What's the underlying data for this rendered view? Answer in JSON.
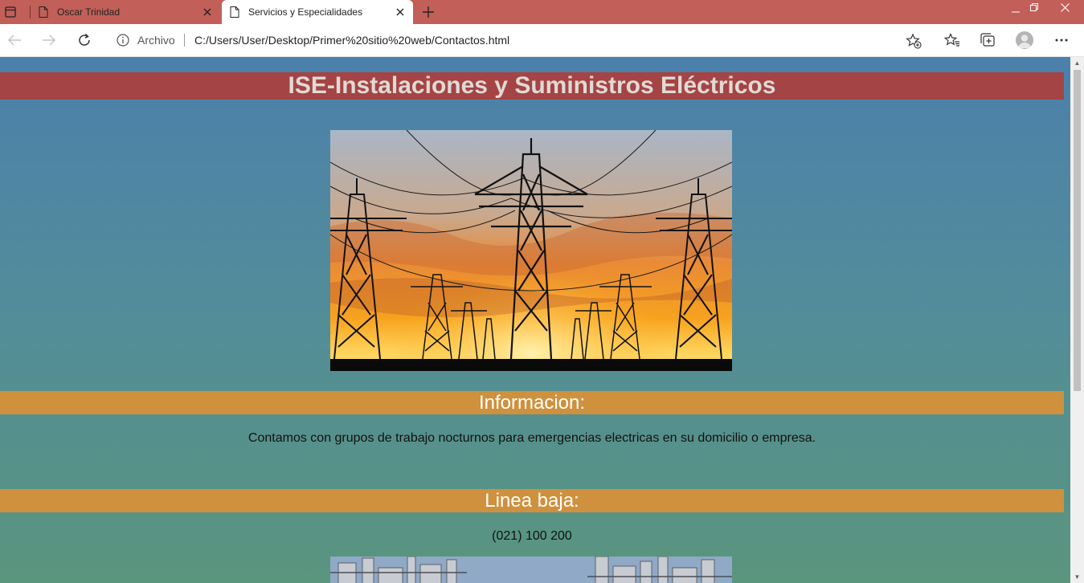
{
  "browser": {
    "tabs": [
      {
        "title": "Oscar Trinidad",
        "active": false
      },
      {
        "title": "Servicios y Especialidades",
        "active": true
      }
    ],
    "address": {
      "scheme_label": "Archivo",
      "url": "C:/Users/User/Desktop/Primer%20sitio%20web/Contactos.html"
    },
    "icons": [
      "tab-actions-icon",
      "page-icon",
      "close-icon",
      "plus-icon",
      "minimize-icon",
      "restore-icon",
      "window-close-icon",
      "back-arrow-icon",
      "forward-arrow-icon",
      "refresh-icon",
      "info-icon",
      "add-favorite-icon",
      "favorites-icon",
      "collections-icon",
      "profile-icon",
      "more-icon"
    ],
    "colors": {
      "titlebar": "#c25f58"
    }
  },
  "page": {
    "title": "ISE-Instalaciones y Suministros Eléctricos",
    "sections": [
      {
        "heading": "Informacion:",
        "text": "Contamos con grupos de trabajo nocturnos para emergencias electricas en su domicilio o empresa."
      },
      {
        "heading": "Linea baja:",
        "text": "(021) 100 200"
      }
    ],
    "colors": {
      "title_bar": "#a54444",
      "section_bar": "#cf913d",
      "background_top": "#4b80ab",
      "background_bottom": "#5a957e"
    }
  }
}
